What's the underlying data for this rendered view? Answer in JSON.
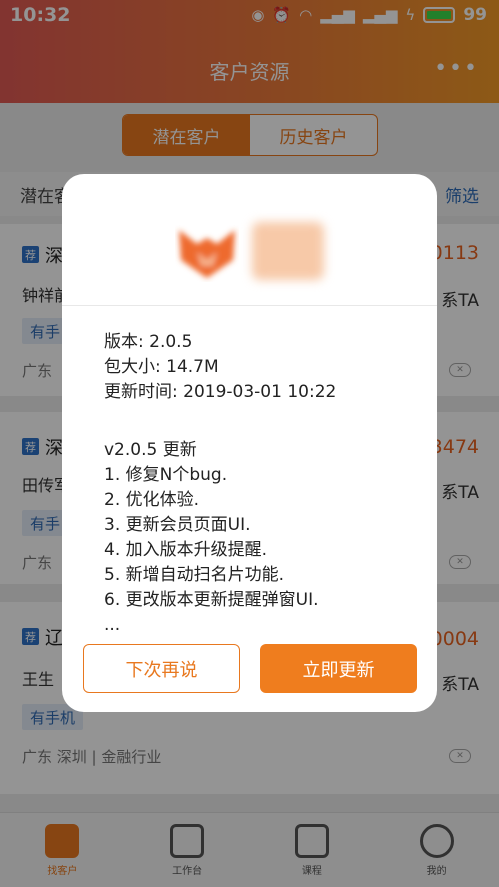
{
  "status_bar": {
    "time": "10:32",
    "battery": "99",
    "net1": "4G",
    "net2": "3G"
  },
  "header": {
    "title": "客户资源",
    "more": "•••"
  },
  "tabs": [
    {
      "label": "潜在客户",
      "active": true
    },
    {
      "label": "历史客户",
      "active": false
    }
  ],
  "subheader": {
    "left": "潜在客",
    "right": "筛选"
  },
  "cards": [
    {
      "badge": "荐",
      "name": "深",
      "phone": "0113",
      "contact": "钟祥前",
      "contact_action": "系TA",
      "tag": "有手",
      "region": "广东"
    },
    {
      "badge": "荐",
      "name": "深",
      "phone": "3474",
      "contact": "田传军",
      "contact_action": "系TA",
      "tag": "有手",
      "region": "广东"
    },
    {
      "badge": "荐",
      "name": "辽",
      "phone": "0004",
      "contact": "王生",
      "contact_action": "系TA",
      "tag": "有手机",
      "region": "广东 深圳 | 金融行业"
    }
  ],
  "close_badge": "✕",
  "bottom_nav": [
    {
      "label": "找客户",
      "active": true
    },
    {
      "label": "工作台",
      "active": false
    },
    {
      "label": "课程",
      "active": false
    },
    {
      "label": "我的",
      "active": false
    }
  ],
  "dialog": {
    "version": "版本: 2.0.5",
    "size": "包大小: 14.7M",
    "update_time": "更新时间: 2019-03-01 10:22",
    "notes_title": "v2.0.5 更新",
    "notes": [
      "1. 修复N个bug.",
      "2. 优化体验.",
      "3. 更新会员页面UI.",
      "4. 加入版本升级提醒.",
      "5. 新增自动扫名片功能.",
      "6. 更改版本更新提醒弹窗UI.",
      "..."
    ],
    "later_label": "下次再说",
    "update_label": "立即更新"
  },
  "colors": {
    "accent": "#ef7d1e",
    "header_start": "#e15a54",
    "header_end": "#f39a27",
    "link": "#2d6bb8"
  }
}
